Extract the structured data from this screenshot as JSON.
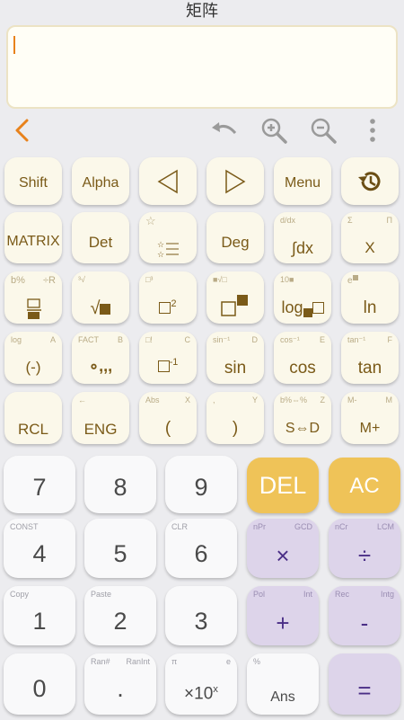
{
  "header": {
    "title": "矩阵"
  },
  "toolbar": {
    "back_icon": "chevron-left-icon",
    "undo_icon": "undo-icon",
    "zoom_in_icon": "zoom-in-icon",
    "zoom_out_icon": "zoom-out-icon",
    "more_icon": "more-vertical-icon"
  },
  "keys": {
    "shift": "Shift",
    "alpha": "Alpha",
    "menu": "Menu",
    "history_icon": "history-icon",
    "matrix": "MATRIX",
    "det": "Det",
    "deg": "Deg",
    "integral": "∫dx",
    "integral_sub": "d/dx",
    "x": "X",
    "x_sub_l": "Σ",
    "x_sub_r": "Π",
    "frac_sub_l": "b%",
    "frac_sub_r": "÷R",
    "sqrt": "√",
    "sqrt_sub": "³√",
    "sq_sub": "□³",
    "pow_sub": "■√□",
    "log": "log",
    "log_sub": "10■",
    "ln": "ln",
    "neg": "(-)",
    "neg_sub_l": "log",
    "neg_sub_r": "A",
    "dms": "∘,,,",
    "dms_sub_l": "FACT",
    "dms_sub_r": "B",
    "inv_sub_l": "□!",
    "inv_sub_r": "C",
    "sin": "sin",
    "sin_sub_l": "sin⁻¹",
    "sin_sub_r": "D",
    "cos": "cos",
    "cos_sub_l": "cos⁻¹",
    "cos_sub_r": "E",
    "tan": "tan",
    "tan_sub_l": "tan⁻¹",
    "tan_sub_r": "F",
    "rcl": "RCL",
    "eng": "ENG",
    "eng_sub": "←",
    "lparen": "(",
    "lparen_sub_l": "Abs",
    "lparen_sub_r": "X",
    "rparen": ")",
    "rparen_sub_l": ",",
    "rparen_sub_r": "Y",
    "sd": "S⇔D",
    "sd_sub_l": "b%⇔%",
    "sd_sub_r": "Z",
    "mplus": "M+",
    "mplus_sub_l": "M-",
    "mplus_sub_r": "M",
    "n7": "7",
    "n8": "8",
    "n9": "9",
    "del": "DEL",
    "ac": "AC",
    "n4": "4",
    "n4_sub": "CONST",
    "n5": "5",
    "n6": "6",
    "n6_sub": "CLR",
    "mul": "×",
    "mul_sub_l": "nPr",
    "mul_sub_r": "GCD",
    "div": "÷",
    "div_sub_l": "nCr",
    "div_sub_r": "LCM",
    "n1": "1",
    "n1_sub": "Copy",
    "n2": "2",
    "n2_sub": "Paste",
    "n3": "3",
    "plus": "+",
    "plus_sub_l": "Pol",
    "plus_sub_r": "Int",
    "minus": "-",
    "minus_sub_l": "Rec",
    "minus_sub_r": "Intg",
    "n0": "0",
    "dot": ".",
    "dot_sub_l": "Ran#",
    "dot_sub_r": "RanInt",
    "exp": "×10",
    "exp_sup": "x",
    "exp_sub_l": "π",
    "exp_sub_r": "e",
    "ans": "Ans",
    "ans_sub": "%",
    "eq": "="
  },
  "colors": {
    "accent": "#e8821c",
    "sci_key": "#fbf8ea",
    "op_key": "#ddd4ea",
    "hot_key": "#efc358"
  }
}
